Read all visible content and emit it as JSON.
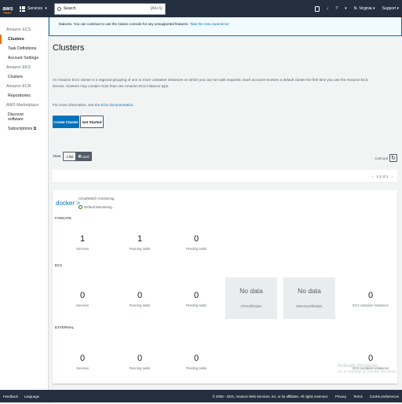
{
  "topbar": {
    "logo": "aws",
    "services_label": "Services",
    "search_placeholder": "Search",
    "search_shortcut": "[Alt+S]",
    "region": "N. Virginia",
    "support": "Support"
  },
  "sidebar": {
    "sections": [
      {
        "title": "Amazon ECS",
        "items": [
          "Clusters",
          "Task Definitions",
          "Account Settings"
        ]
      },
      {
        "title": "Amazon EKS",
        "items": [
          "Clusters"
        ]
      },
      {
        "title": "Amazon ECR",
        "items": [
          "Repositories"
        ]
      },
      {
        "title": "AWS Marketplace",
        "items": [
          "Discover software",
          "Subscriptions ⧉"
        ]
      }
    ]
  },
  "banner": {
    "text": "features. You can continue to use the classic console for any unsupported features.",
    "link": "Take the new experience"
  },
  "page": {
    "title": "Clusters",
    "description": "An Amazon ECS cluster is a regional grouping of one or more container instances on which you can run task requests. Each account receives a default cluster the first time you use the Amazon ECS service. Clusters may contain more than one Amazon EC2 instance type.",
    "more_info_prefix": "For more information, see the",
    "more_info_link": "ECS documentation.",
    "create_button": "Create Cluster",
    "get_started_button": "Get Started",
    "view_label": "View",
    "view_list": "list",
    "view_card": "card",
    "last_updated": "Last upd",
    "pager_text": "1-1 of 1"
  },
  "cluster": {
    "name": "docker",
    "arrow": ">",
    "cloudwatch_label": "CloudWatch monitoring",
    "cloudwatch_status": "Default Monitoring",
    "sections": {
      "fargate": "FARGATE",
      "ec2": "EC2",
      "external": "EXTERNAL"
    },
    "fargate": [
      {
        "value": "1",
        "label": "Services"
      },
      {
        "value": "1",
        "label": "Running tasks"
      },
      {
        "value": "0",
        "label": "Pending tasks"
      }
    ],
    "ec2": [
      {
        "value": "0",
        "label": "Services"
      },
      {
        "value": "0",
        "label": "Running tasks"
      },
      {
        "value": "0",
        "label": "Pending tasks"
      }
    ],
    "ec2_nodata": [
      {
        "title": "No data",
        "label": "CPUUtilization"
      },
      {
        "title": "No data",
        "label": "MemoryUtilization"
      }
    ],
    "ec2_instances": {
      "value": "0",
      "label": "EC2 container instances"
    },
    "external": [
      {
        "value": "0",
        "label": "Services"
      },
      {
        "value": "0",
        "label": "Running tasks"
      },
      {
        "value": "0",
        "label": "Pending tasks"
      }
    ],
    "external_instances": {
      "value": "0",
      "label": "ECS container instances"
    }
  },
  "watermark": {
    "title": "Activate Windows",
    "subtitle": "Go to Settings to activate Windows."
  },
  "footer": {
    "feedback": "Feedback",
    "language": "Language",
    "copyright": "© 2008 - 2021, Amazon Web Services, Inc. or its affiliates. All rights reserved.",
    "privacy": "Privacy",
    "terms": "Terms",
    "cookie": "Cookie preferences"
  }
}
